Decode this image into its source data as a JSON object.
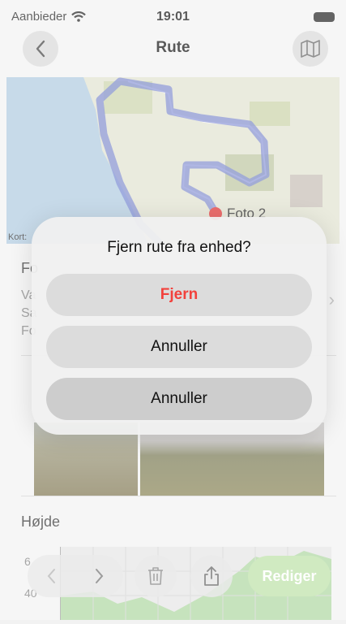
{
  "status_bar": {
    "carrier": "Aanbieder",
    "time": "19:01"
  },
  "nav": {
    "title": "Rute"
  },
  "map": {
    "credit": "Kort:",
    "pin_label": "Foto 2",
    "route_color": "#5b6bc8"
  },
  "content": {
    "section1_title": "Fo",
    "lines": [
      "Va",
      "Sa",
      "Fo"
    ],
    "height_title": "Højde",
    "y_ticks": [
      "6",
      "40"
    ]
  },
  "toolbar": {
    "edit_label": "Rediger"
  },
  "alert": {
    "title": "Fjern rute fra enhed?",
    "buttons": [
      {
        "label": "Fjern",
        "style": "destructive"
      },
      {
        "label": "Annuller",
        "style": "default"
      },
      {
        "label": "Annuller",
        "style": "default"
      }
    ]
  },
  "colors": {
    "destructive": "#f2413c",
    "accent_green": "#b7dfa0"
  }
}
